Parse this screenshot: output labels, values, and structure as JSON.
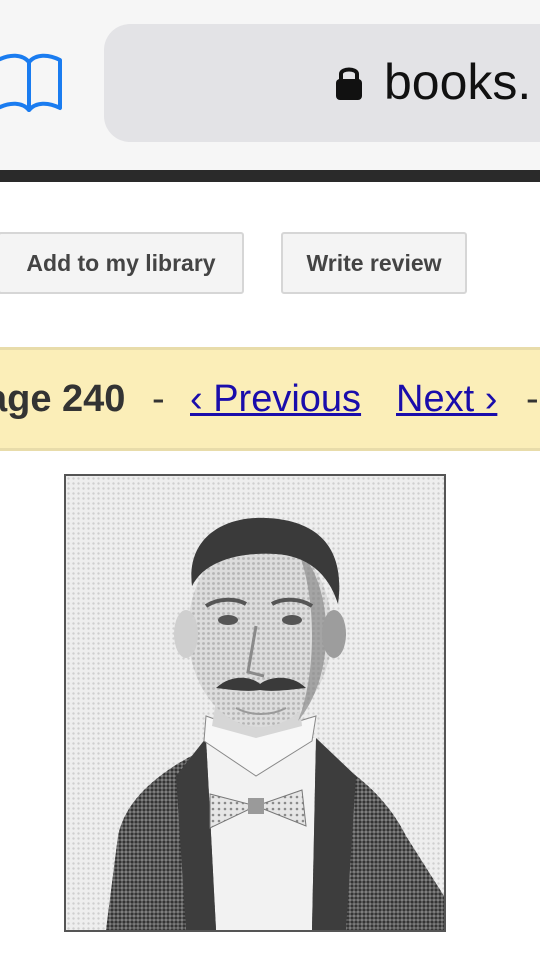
{
  "browser": {
    "url_text": "books.",
    "icons": {
      "bookmarks": "bookmarks-book-icon",
      "lock": "lock-icon"
    },
    "accent_color": "#1a7cf0"
  },
  "toolbar": {
    "add_library_label": "Add to my library",
    "write_review_label": "Write review"
  },
  "pagenav": {
    "page_label": "age 240",
    "separator": "-",
    "previous_label": "‹ Previous",
    "next_label": "Next ›",
    "background_color": "#fbeeb8",
    "link_color": "#1a0dab"
  },
  "content": {
    "image_subject": "scanned halftone portrait"
  }
}
